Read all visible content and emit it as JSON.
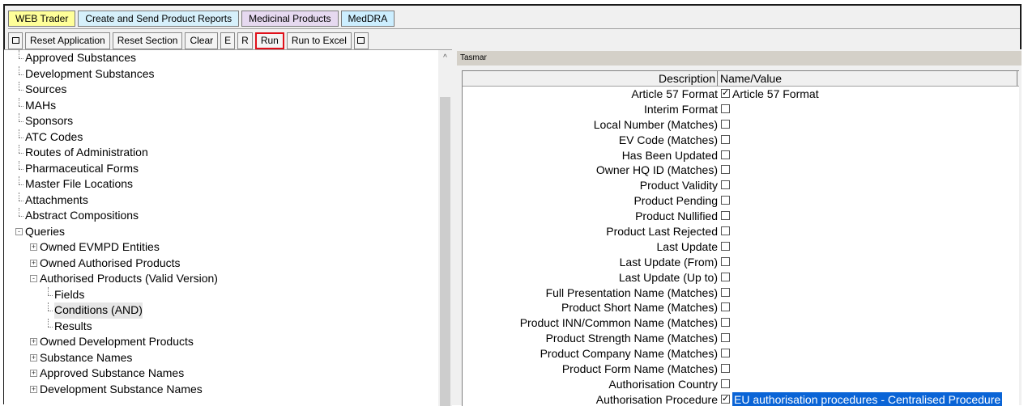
{
  "tabs": [
    {
      "label": "WEB Trader",
      "color": "#ffff99"
    },
    {
      "label": "Create and Send Product Reports",
      "color": "#d6f0fb"
    },
    {
      "label": "Medicinal Products",
      "color": "#e6d9f0"
    },
    {
      "label": "MedDRA",
      "color": "#cceeff"
    }
  ],
  "toolbar": {
    "reset_application": "Reset Application",
    "reset_section": "Reset Section",
    "clear": "Clear",
    "e": "E",
    "r": "R",
    "run": "Run",
    "run_to_excel": "Run to Excel"
  },
  "tree": {
    "items": [
      {
        "label": "Approved Substances"
      },
      {
        "label": "Development Substances"
      },
      {
        "label": "Sources"
      },
      {
        "label": "MAHs"
      },
      {
        "label": "Sponsors"
      },
      {
        "label": "ATC Codes"
      },
      {
        "label": "Routes of Administration"
      },
      {
        "label": "Pharmaceutical Forms"
      },
      {
        "label": "Master File Locations"
      },
      {
        "label": "Attachments"
      },
      {
        "label": "Abstract Compositions"
      },
      {
        "label": "Queries"
      },
      {
        "label": "Owned EVMPD Entities"
      },
      {
        "label": "Owned Authorised Products"
      },
      {
        "label": "Authorised Products (Valid Version)"
      },
      {
        "label": "Fields"
      },
      {
        "label": "Conditions (AND)"
      },
      {
        "label": "Results"
      },
      {
        "label": "Owned Development Products"
      },
      {
        "label": "Substance Names"
      },
      {
        "label": "Approved Substance Names"
      },
      {
        "label": "Development Substance Names"
      }
    ]
  },
  "panel": {
    "title": "Tasmar"
  },
  "grid": {
    "col_description": "Description",
    "col_value": "Name/Value",
    "rows": [
      {
        "description": "Article 57 Format",
        "checked": true,
        "value": "Article 57 Format"
      },
      {
        "description": "Interim Format",
        "checked": false,
        "value": ""
      },
      {
        "description": "Local Number (Matches)",
        "checked": false,
        "value": ""
      },
      {
        "description": "EV Code (Matches)",
        "checked": false,
        "value": ""
      },
      {
        "description": "Has Been Updated",
        "checked": false,
        "value": ""
      },
      {
        "description": "Owner HQ ID (Matches)",
        "checked": false,
        "value": ""
      },
      {
        "description": "Product Validity",
        "checked": false,
        "value": ""
      },
      {
        "description": "Product Pending",
        "checked": false,
        "value": ""
      },
      {
        "description": "Product Nullified",
        "checked": false,
        "value": ""
      },
      {
        "description": "Product Last Rejected",
        "checked": false,
        "value": ""
      },
      {
        "description": "Last Update",
        "checked": false,
        "value": ""
      },
      {
        "description": "Last Update (From)",
        "checked": false,
        "value": ""
      },
      {
        "description": "Last Update (Up to)",
        "checked": false,
        "value": ""
      },
      {
        "description": "Full Presentation Name (Matches)",
        "checked": false,
        "value": ""
      },
      {
        "description": "Product Short Name (Matches)",
        "checked": false,
        "value": ""
      },
      {
        "description": "Product INN/Common Name (Matches)",
        "checked": false,
        "value": ""
      },
      {
        "description": "Product Strength Name (Matches)",
        "checked": false,
        "value": ""
      },
      {
        "description": "Product Company Name (Matches)",
        "checked": false,
        "value": ""
      },
      {
        "description": "Product Form Name (Matches)",
        "checked": false,
        "value": ""
      },
      {
        "description": "Authorisation Country",
        "checked": false,
        "value": ""
      },
      {
        "description": "Authorisation Procedure",
        "checked": true,
        "value": "EU authorisation procedures  - Centralised Procedure",
        "selected": true
      }
    ]
  },
  "colors": {
    "highlight": "#0a64d6",
    "run_border": "#e0101a"
  }
}
